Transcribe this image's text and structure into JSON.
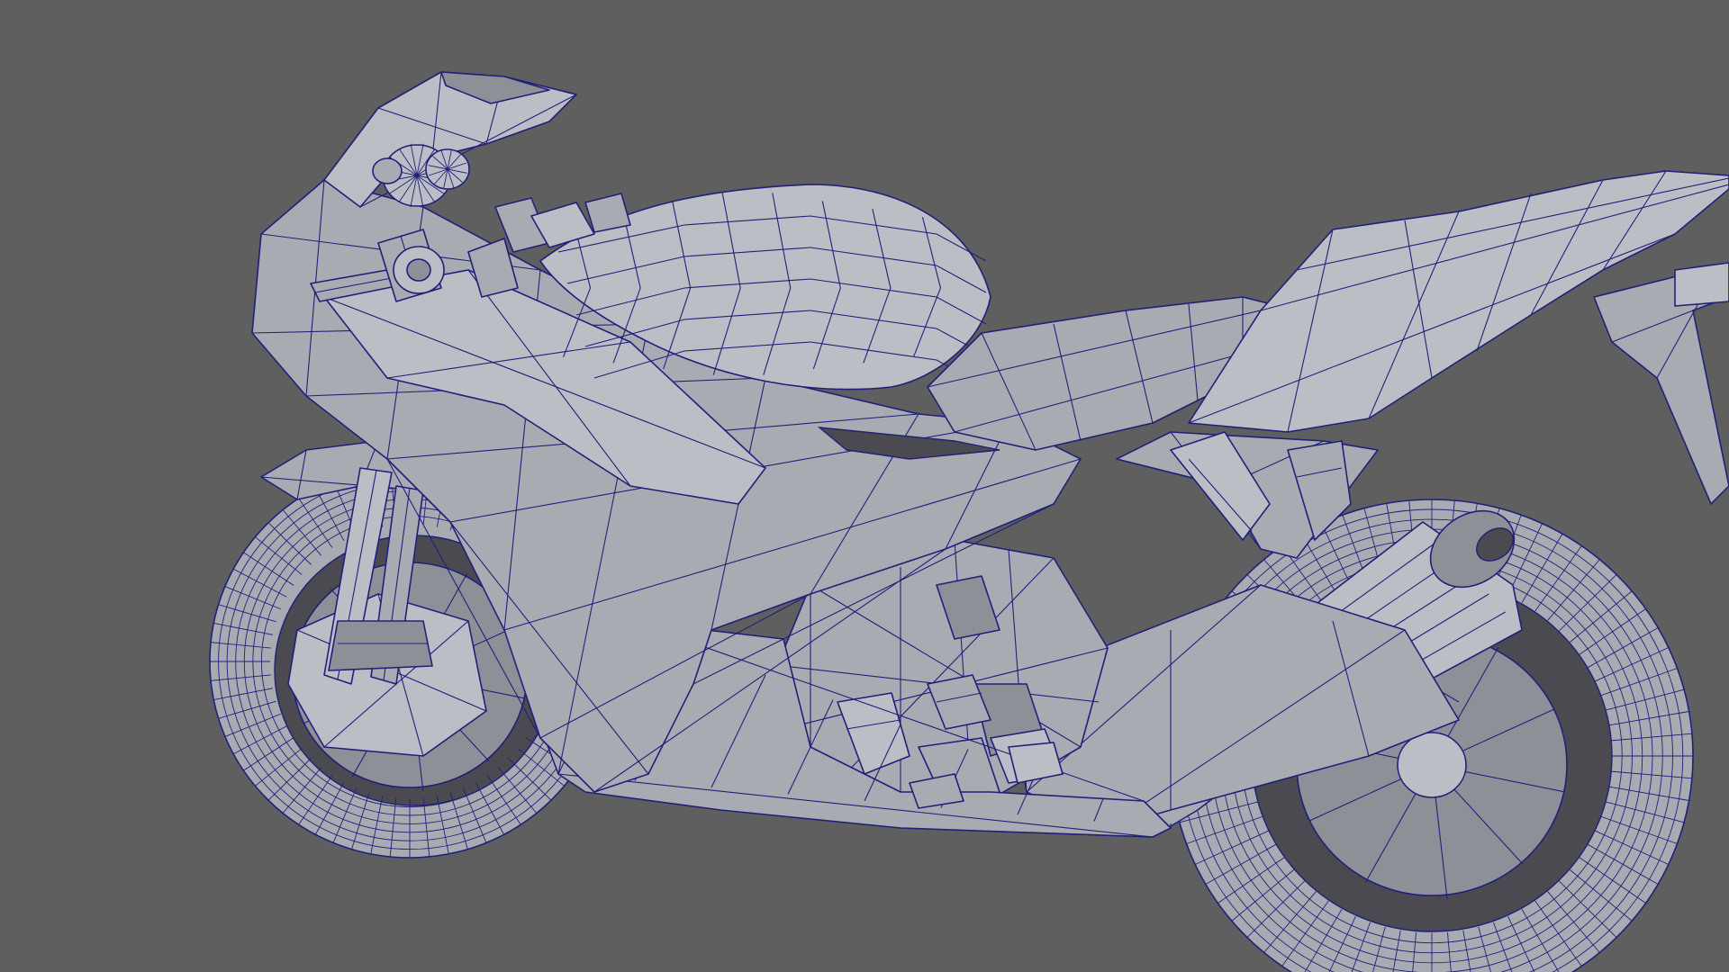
{
  "viewport": {
    "background_color": "#5f5f5f",
    "mesh_fill_color": "#a9abb2",
    "wireframe_color": "#20207a"
  },
  "scene": {
    "subject": "motorcycle-mesh",
    "parts": [
      "windscreen",
      "gauges",
      "handlebar",
      "fairing",
      "fuel-tank",
      "seat",
      "tail",
      "front-wheel",
      "front-fork",
      "engine",
      "frame",
      "exhaust",
      "rear-wheel",
      "rear-mudguard"
    ]
  }
}
